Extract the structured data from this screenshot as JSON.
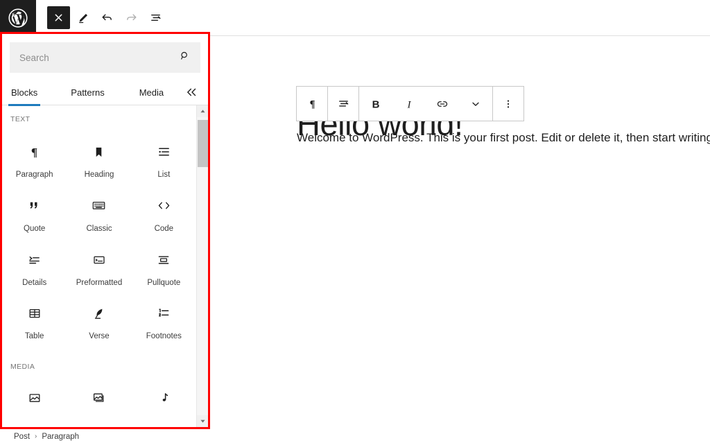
{
  "topbar": {
    "logo_icon": "wordpress-logo",
    "buttons": [
      {
        "icon": "close-icon",
        "label": "Close block inserter",
        "state": "active"
      },
      {
        "icon": "pencil-edit-icon",
        "label": "Edit",
        "state": "normal"
      },
      {
        "icon": "undo-icon",
        "label": "Undo",
        "state": "normal"
      },
      {
        "icon": "redo-icon",
        "label": "Redo",
        "state": "disabled"
      },
      {
        "icon": "list-view-icon",
        "label": "Document overview",
        "state": "normal"
      }
    ]
  },
  "inserter": {
    "highlight_color": "#ff0000",
    "search": {
      "placeholder": "Search",
      "value": "",
      "icon": "search-icon"
    },
    "tabs": [
      {
        "label": "Blocks",
        "active": true
      },
      {
        "label": "Patterns",
        "active": false
      },
      {
        "label": "Media",
        "active": false
      }
    ],
    "close_icon": "double-chevron-left-icon",
    "active_tab_color": "#1e7bbd",
    "categories": [
      {
        "label": "TEXT",
        "blocks": [
          {
            "label": "Paragraph",
            "icon": "pilcrow-icon"
          },
          {
            "label": "Heading",
            "icon": "bookmark-icon"
          },
          {
            "label": "List",
            "icon": "list-icon"
          },
          {
            "label": "Quote",
            "icon": "quote-icon"
          },
          {
            "label": "Classic",
            "icon": "keyboard-icon"
          },
          {
            "label": "Code",
            "icon": "angle-brackets-icon"
          },
          {
            "label": "Details",
            "icon": "details-icon"
          },
          {
            "label": "Preformatted",
            "icon": "preformatted-icon"
          },
          {
            "label": "Pullquote",
            "icon": "pullquote-icon"
          },
          {
            "label": "Table",
            "icon": "table-icon"
          },
          {
            "label": "Verse",
            "icon": "quill-icon"
          },
          {
            "label": "Footnotes",
            "icon": "footnotes-icon"
          }
        ]
      },
      {
        "label": "MEDIA",
        "blocks": [
          {
            "label": "",
            "icon": "image-icon"
          },
          {
            "label": "",
            "icon": "gallery-icon"
          },
          {
            "label": "",
            "icon": "audio-icon"
          }
        ]
      }
    ],
    "scrollbar": {
      "up_icon": "scroll-up-arrow-icon",
      "down_icon": "scroll-down-arrow-icon"
    }
  },
  "canvas": {
    "title": "Hello world!",
    "paragraph": "Welcome to WordPress. This is your first post. Edit or delete it, then start writing!",
    "block_toolbar": [
      {
        "icon": "pilcrow-icon",
        "label": "Paragraph block type"
      },
      {
        "icon": "align-icon",
        "label": "Align text"
      },
      {
        "icon": "bold-icon",
        "label": "Bold"
      },
      {
        "icon": "italic-icon",
        "label": "Italic"
      },
      {
        "icon": "link-icon",
        "label": "Link"
      },
      {
        "icon": "chevron-down-icon",
        "label": "More rich text controls"
      },
      {
        "icon": "vertical-dots-icon",
        "label": "Options"
      }
    ]
  },
  "breadcrumb": {
    "items": [
      "Post",
      "Paragraph"
    ],
    "separator": "›"
  }
}
